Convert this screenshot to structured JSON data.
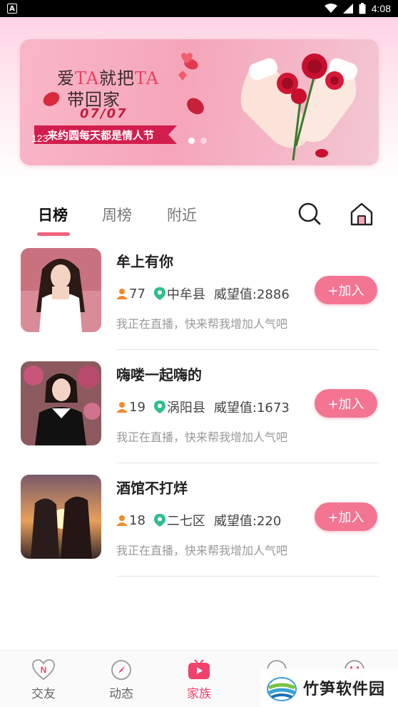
{
  "status_bar": {
    "time": "4:08",
    "app_icon_letter": "A"
  },
  "banner": {
    "title_line1_a": "爱",
    "title_line1_b": "TA",
    "title_line1_c": "就把",
    "title_line1_d": "TA",
    "title_line2": "带回家",
    "date": "07/07",
    "ribbon": "来约圆每天都是情人节",
    "caption": "123",
    "dots": 2,
    "active_dot": 0
  },
  "tabs": [
    {
      "label": "日榜",
      "active": true
    },
    {
      "label": "周榜",
      "active": false
    },
    {
      "label": "附近",
      "active": false
    }
  ],
  "tab_icons": [
    "search-icon",
    "home-icon"
  ],
  "families": [
    {
      "name": "牟上有你",
      "members": "77",
      "location": "中牟县",
      "prestige": "威望值:2886",
      "desc": "我正在直播，快来帮我增加人气吧",
      "button": "+加入"
    },
    {
      "name": "嗨喽一起嗨的",
      "members": "19",
      "location": "涡阳县",
      "prestige": "威望值:1673",
      "desc": "我正在直播，快来帮我增加人气吧",
      "button": "+加入"
    },
    {
      "name": "酒馆不打烊",
      "members": "18",
      "location": "二七区",
      "prestige": "威望值:220",
      "desc": "我正在直播，快来帮我增加人气吧",
      "button": "+加入"
    }
  ],
  "bottom_nav": [
    {
      "label": "交友",
      "icon": "heart-n-icon",
      "active": false
    },
    {
      "label": "动态",
      "icon": "compass-icon",
      "active": false
    },
    {
      "label": "家族",
      "icon": "tv-play-icon",
      "active": true
    },
    {
      "label": "",
      "icon": "chat-dots-icon",
      "active": false
    },
    {
      "label": "",
      "icon": "smile-face-icon",
      "active": false
    }
  ],
  "watermark": {
    "text": "竹笋软件园"
  },
  "colors": {
    "accent": "#f37592",
    "tab_underline": "#f2647f",
    "member_icon": "#f08a2a",
    "location_icon": "#2fbf8a",
    "nav_active": "#f0426a"
  }
}
